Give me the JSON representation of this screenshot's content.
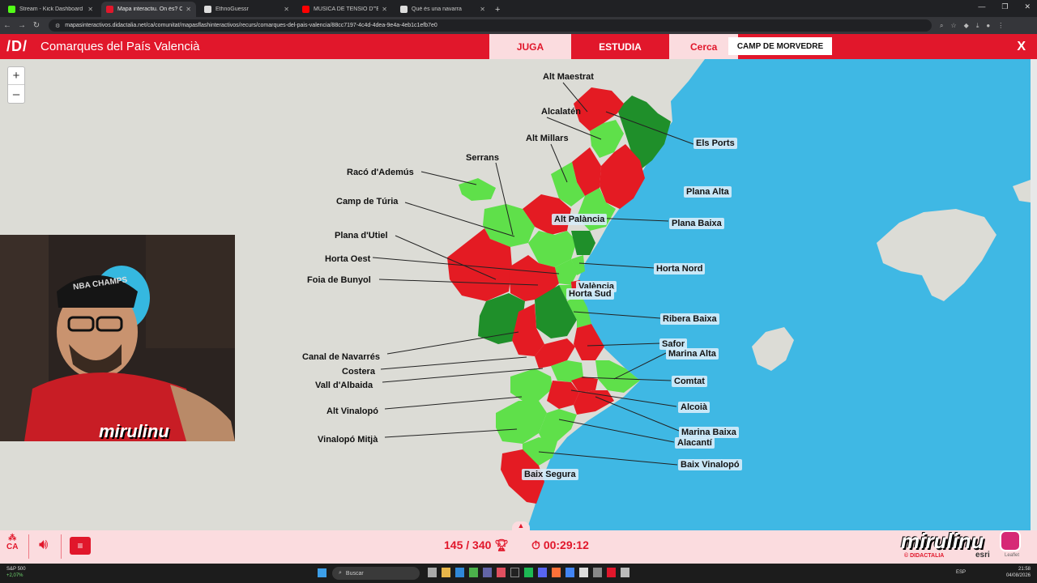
{
  "browser": {
    "tabs": [
      {
        "title": "Stream - Kick Dashboard",
        "color": "#53fc18"
      },
      {
        "title": "Mapa interactiu. On és? Comu",
        "color": "#e1172b"
      },
      {
        "title": "EthnoGuessr",
        "color": "#dddddd"
      },
      {
        "title": "MÚSICA DE TENSIÓ D'\"EL",
        "color": "#ff0000"
      },
      {
        "title": "Què és una navarra",
        "color": "#dddddd"
      }
    ],
    "url": "mapasinteractivos.didactalia.net/ca/comunitat/mapasflashinteractivos/recurs/comarques-del-pais-valencia/88cc7197-4c4d-4dea-9e4a-4eb1c1efb7e0"
  },
  "app": {
    "logo": "/D/",
    "title": "Comarques del País Valencià",
    "tabs": {
      "juga": "JUGA",
      "estudia": "ESTUDIA",
      "cerca": "Cerca"
    },
    "search_value": "CAMP DE MORVEDRE",
    "close": "X"
  },
  "map": {
    "zoom_in": "+",
    "zoom_out": "–",
    "colors": {
      "sea": "#3fb8e4",
      "land": "#dcdcd6",
      "correct_first": "#5fe04a",
      "correct_late": "#1f8f2a",
      "wrong": "#e41b23"
    },
    "labels": {
      "alt_maestrat": "Alt Maestrat",
      "alcalaten": "Alcalatén",
      "alt_millars": "Alt Millars",
      "serrans": "Serrans",
      "raco_ademus": "Racó d'Ademús",
      "camp_turia": "Camp de Túria",
      "plana_utiel": "Plana d'Utiel",
      "horta_oest": "Horta Oest",
      "foia_bunyol": "Foia de Bunyol",
      "canal_navarres": "Canal de Navarrés",
      "costera": "Costera",
      "vall_albaida": "Vall d'Albaida",
      "alt_vinalopo": "Alt Vinalopó",
      "vinalopo_mitja": "Vinalopó Mitjà",
      "els_ports": "Els Ports",
      "plana_alta": "Plana Alta",
      "alt_palancia": "Alt Palància",
      "plana_baixa": "Plana Baixa",
      "horta_nord": "Horta Nord",
      "valencia": "València",
      "horta_sud": "Horta Sud",
      "ribera_baixa": "Ribera Baixa",
      "safor": "Safor",
      "marina_alta": "Marina Alta",
      "comtat": "Comtat",
      "alcoia": "Alcoià",
      "marina_baixa": "Marina Baixa",
      "alacanti": "Alacantí",
      "baix_vinalopo": "Baix Vinalopó",
      "baix_segura": "Baix Segura"
    }
  },
  "footer": {
    "lang": "CA",
    "score": "145 / 340",
    "timer": "00:29:12",
    "brand": "mirulinu",
    "credit1": "© DIDACTALIA",
    "credit2": "esri",
    "credit3": "Leaflet"
  },
  "webcam": {
    "overlay": "mirulinu",
    "cap": "NBA CHAMPS"
  },
  "taskbar": {
    "stock_name": "S&P 500",
    "stock_change": "+2,07%",
    "search": "Buscar",
    "lang": "ESP",
    "time": "21:58",
    "date": "04/08/2026"
  }
}
